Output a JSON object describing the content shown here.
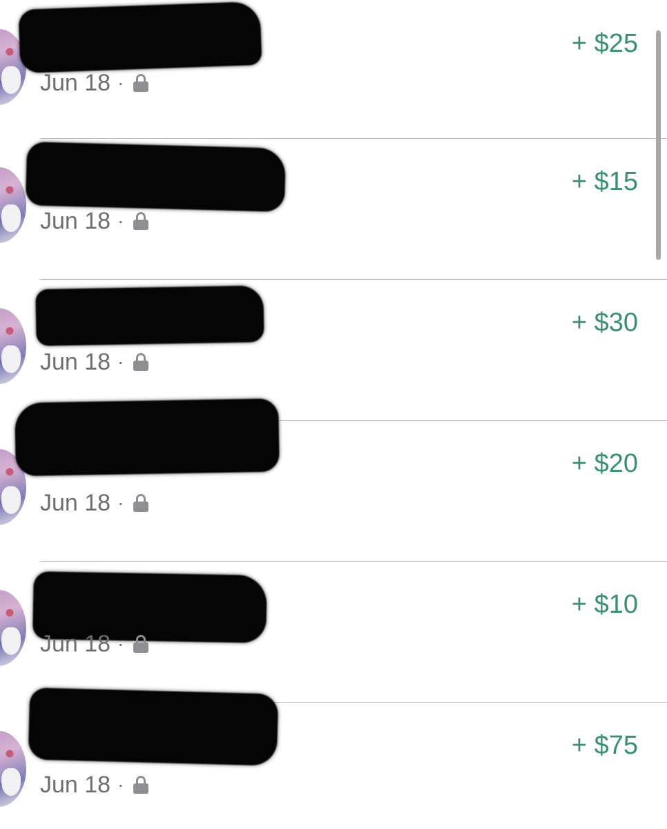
{
  "transactions": [
    {
      "date": "Jun 18",
      "separator": "·",
      "amount": "+ $25",
      "privacy_icon": "lock-icon"
    },
    {
      "date": "Jun 18",
      "separator": "·",
      "amount": "+ $15",
      "privacy_icon": "lock-icon"
    },
    {
      "date": "Jun 18",
      "separator": "·",
      "amount": "+ $30",
      "privacy_icon": "lock-icon"
    },
    {
      "date": "Jun 18",
      "separator": "·",
      "amount": "+ $20",
      "privacy_icon": "lock-icon"
    },
    {
      "date": "Jun 18",
      "separator": "·",
      "amount": "+ $10",
      "privacy_icon": "lock-icon"
    },
    {
      "date": "Jun 18",
      "separator": "·",
      "amount": "+ $75",
      "privacy_icon": "lock-icon"
    }
  ],
  "colors": {
    "amount": "#3b8f70",
    "meta_text": "#6f6f73",
    "divider": "#b9b9b9",
    "redaction": "#050505"
  }
}
